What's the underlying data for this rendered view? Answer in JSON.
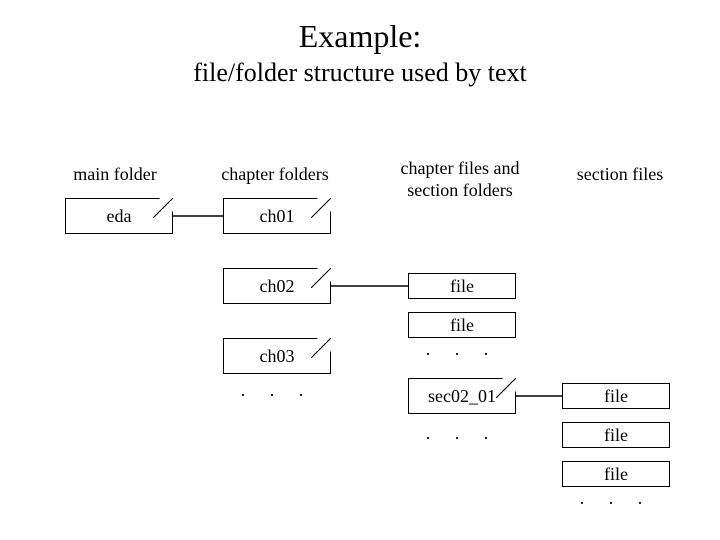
{
  "title": "Example:",
  "subtitle": "file/folder structure used by text",
  "headers": {
    "main": "main folder",
    "chapter_folders": "chapter folders",
    "chapter_files": "chapter files and section folders",
    "section_files": "section files"
  },
  "main_folder": "eda",
  "chapter_folders": [
    "ch01",
    "ch02",
    "ch03"
  ],
  "chapter_file1": "file",
  "chapter_file2": "file",
  "section_folder": "sec02_01",
  "section_files": [
    "file",
    "file",
    "file"
  ],
  "ellipsis": ". . ."
}
